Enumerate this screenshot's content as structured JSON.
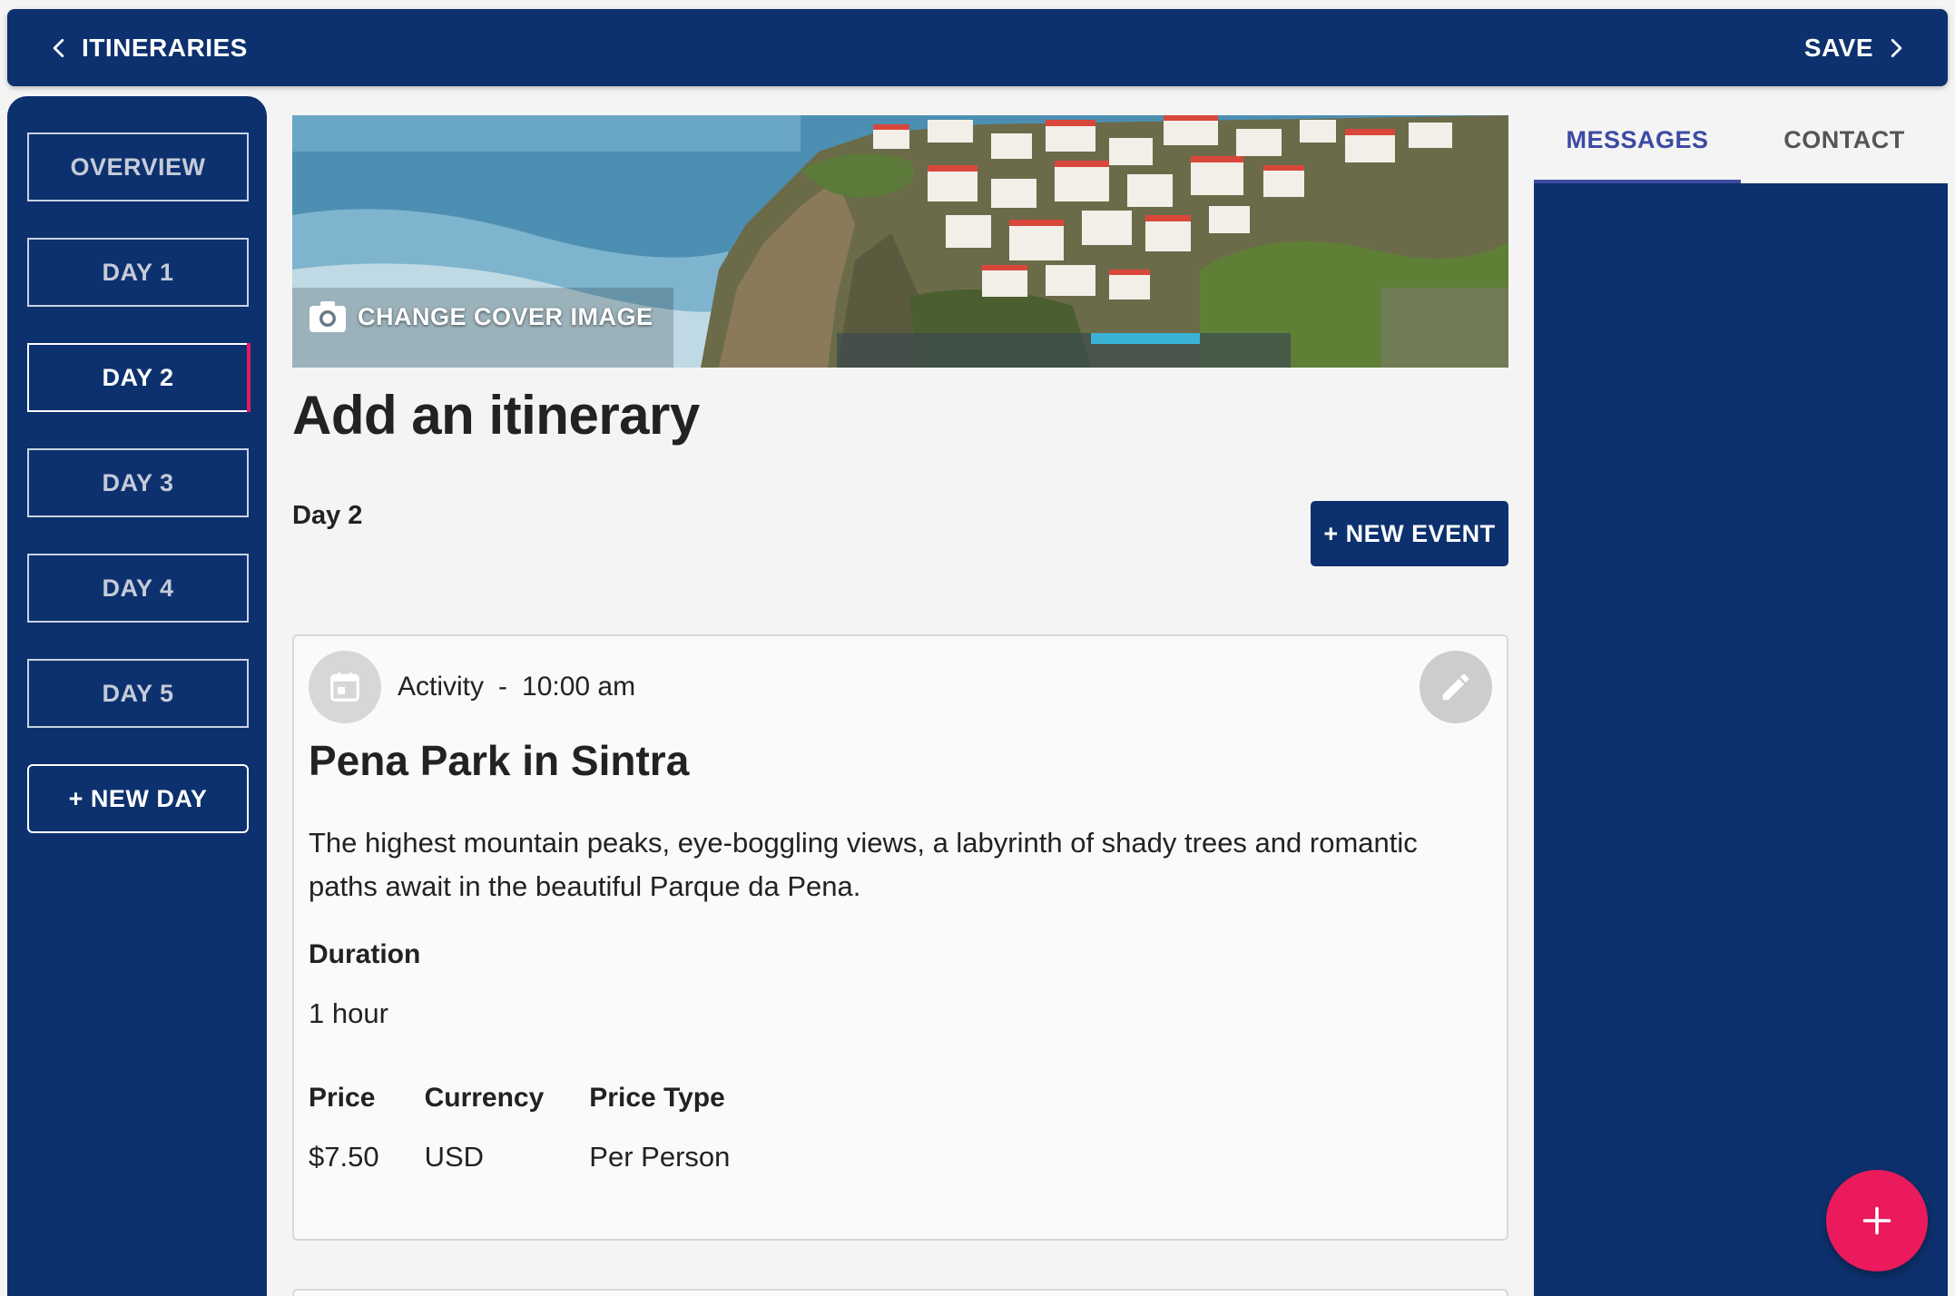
{
  "topbar": {
    "back_label": "ITINERARIES",
    "save_label": "SAVE"
  },
  "sidebar": {
    "items": [
      {
        "label": "OVERVIEW"
      },
      {
        "label": "DAY 1"
      },
      {
        "label": "DAY 2",
        "active": true
      },
      {
        "label": "DAY 3"
      },
      {
        "label": "DAY 4"
      },
      {
        "label": "DAY 5"
      }
    ],
    "new_day_label": "+ NEW DAY"
  },
  "cover": {
    "change_label": "CHANGE COVER IMAGE"
  },
  "main": {
    "title": "Add an itinerary",
    "day_label": "Day 2",
    "new_event_label": "+ NEW EVENT"
  },
  "event": {
    "type": "Activity",
    "separator": "-",
    "time": "10:00 am",
    "title": "Pena Park in Sintra",
    "description": "The highest mountain peaks, eye-boggling views, a labyrinth of shady trees and romantic paths await in the beautiful Parque da Pena.",
    "duration_label": "Duration",
    "duration_value": "1 hour",
    "price_label": "Price",
    "price_value": "$7.50",
    "currency_label": "Currency",
    "currency_value": "USD",
    "price_type_label": "Price Type",
    "price_type_value": "Per Person"
  },
  "right_panel": {
    "tabs": [
      {
        "label": "MESSAGES",
        "active": true
      },
      {
        "label": "CONTACT"
      }
    ]
  },
  "colors": {
    "primary": "#0d316e",
    "accent": "#ea1a5c",
    "tab_active": "#3d4aa3"
  }
}
